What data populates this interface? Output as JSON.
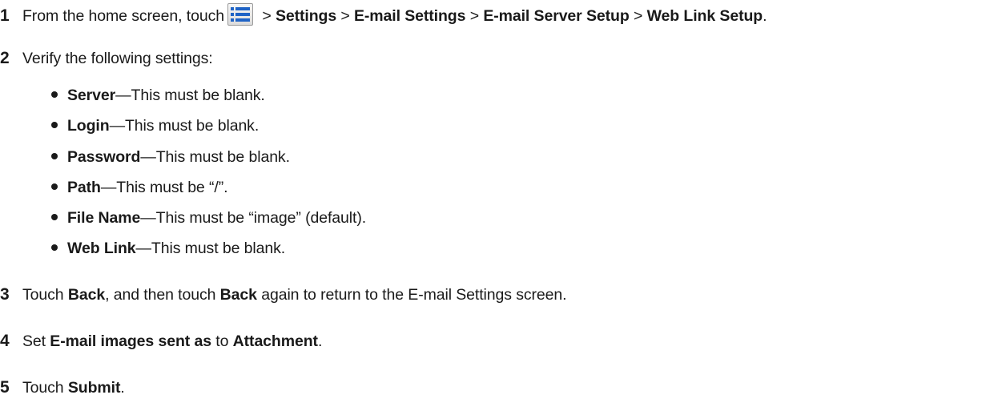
{
  "steps": [
    {
      "number": "1",
      "text_pre": "From the home screen, touch",
      "icon": "menu-list-icon",
      "sep1": " > ",
      "b1": "Settings",
      "sep2": " > ",
      "b2": "E-mail Settings",
      "sep3": " > ",
      "b3": "E-mail Server Setup",
      "sep4": " > ",
      "b4": "Web Link Setup",
      "end": "."
    },
    {
      "number": "2",
      "text": "Verify the following settings:",
      "bullets": [
        {
          "term": "Server",
          "desc": "—This must be blank."
        },
        {
          "term": "Login",
          "desc": "—This must be blank."
        },
        {
          "term": "Password",
          "desc": "—This must be blank."
        },
        {
          "term": "Path",
          "desc": "—This must be “/”."
        },
        {
          "term": "File Name",
          "desc": "—This must be “image” (default)."
        },
        {
          "term": "Web Link",
          "desc": "—This must be blank."
        }
      ]
    },
    {
      "number": "3",
      "t1": "Touch ",
      "b1": "Back",
      "t2": ", and then touch ",
      "b2": "Back",
      "t3": " again to return to the E-mail Settings screen."
    },
    {
      "number": "4",
      "t1": "Set ",
      "b1": "E-mail images sent as",
      "t2": " to ",
      "b2": "Attachment",
      "t3": "."
    },
    {
      "number": "5",
      "t1": "Touch ",
      "b1": "Submit",
      "t2": "."
    }
  ],
  "colors": {
    "text": "#1a1a1a",
    "icon_blue": "#1f63c6"
  }
}
